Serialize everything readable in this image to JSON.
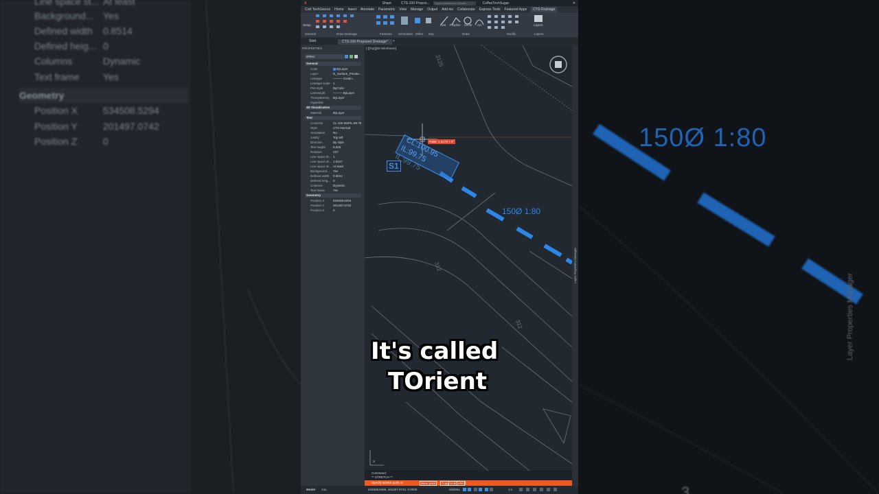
{
  "background_left": {
    "rows": [
      {
        "key": "Line space st...",
        "value": "At least"
      },
      {
        "key": "Background...",
        "value": "Yes"
      },
      {
        "key": "Defined width",
        "value": "0.8514"
      },
      {
        "key": "Defined heig...",
        "value": "0"
      },
      {
        "key": "Columns",
        "value": "Dynamic"
      },
      {
        "key": "Text frame",
        "value": "Yes"
      }
    ],
    "geometry_head": "Geometry",
    "geometry_rows": [
      {
        "key": "Position X",
        "value": "534508.5294"
      },
      {
        "key": "Position Y",
        "value": "201497.0742"
      },
      {
        "key": "Position Z",
        "value": "0"
      }
    ]
  },
  "background_right": {
    "pipe_label": "150Ø 1:80",
    "lpm_label": "Layer Properties Manager",
    "bottom_digit": "3"
  },
  "titlebar": {
    "share": "Share",
    "doc_title": "CTS-100-Propos...",
    "search_placeholder": "Type a keyword or phrase",
    "user": "CoffeeTechSugar"
  },
  "menu": [
    "Civil TechSource",
    "Home",
    "Insert",
    "Annotate",
    "Parametric",
    "View",
    "Manage",
    "Output",
    "Add-ins",
    "Collaborate",
    "Express Tools",
    "Featured Apps",
    "CTS-Drainage"
  ],
  "menu_active": "CTS-Drainage",
  "ribbon_groups": [
    "General",
    "Draw Drainage",
    "Features",
    "Schedules",
    "Other",
    "Key",
    "Draw",
    "Modify",
    "Layers"
  ],
  "ribbon_buttons": {
    "setup": "Setup",
    "line": "Line",
    "polyline": "Polyline",
    "circle": "Circle",
    "arc": "Arc",
    "layers": "Layers"
  },
  "doc_tabs": {
    "start": "Start",
    "active": "CTS-100-Proposed Drainage*"
  },
  "properties": {
    "title": "PROPERTIES",
    "selection": "MText",
    "sections": [
      {
        "name": "General",
        "rows": [
          {
            "key": "Color",
            "value": "ByLayer"
          },
          {
            "key": "Layer",
            "value": "D_Surface_Private..."
          },
          {
            "key": "Linetype",
            "value": "——— Contin..."
          },
          {
            "key": "Linetype scale",
            "value": "1"
          },
          {
            "key": "Plot style",
            "value": "ByColor"
          },
          {
            "key": "Lineweight",
            "value": "——— ByLayer"
          },
          {
            "key": "Transparency",
            "value": "ByLayer"
          },
          {
            "key": "Hyperlink",
            "value": ""
          }
        ]
      },
      {
        "name": "3D Visualization",
        "rows": [
          {
            "key": "Material",
            "value": "ByLayer"
          }
        ]
      },
      {
        "name": "Text",
        "rows": [
          {
            "key": "Contents",
            "value": "CL:100.95\\PIL:99.75"
          },
          {
            "key": "Style",
            "value": "CTS-Normal"
          },
          {
            "key": "Annotative",
            "value": "No"
          },
          {
            "key": "Justify",
            "value": "Top left"
          },
          {
            "key": "Direction",
            "value": "By style"
          },
          {
            "key": "Text height",
            "value": "0.625"
          },
          {
            "key": "Rotation",
            "value": "227"
          },
          {
            "key": "Line space fa...",
            "value": "1"
          },
          {
            "key": "Line space di...",
            "value": "1.0417"
          },
          {
            "key": "Line space st...",
            "value": "At least"
          },
          {
            "key": "Background...",
            "value": "Yes"
          },
          {
            "key": "Defined width",
            "value": "0.8514"
          },
          {
            "key": "Defined heig...",
            "value": "0"
          },
          {
            "key": "Columns",
            "value": "Dynamic"
          },
          {
            "key": "Text frame",
            "value": "Yes"
          }
        ]
      },
      {
        "name": "Geometry",
        "rows": [
          {
            "key": "Position X",
            "value": "534508.5294"
          },
          {
            "key": "Position Y",
            "value": "201497.0742"
          },
          {
            "key": "Position Z",
            "value": "0"
          }
        ]
      }
    ]
  },
  "drawing": {
    "view_label": "[-][Top][2D Wireframe]",
    "cursor_tip": "Polar: 1.5173 < 0°",
    "mtext_lines": [
      "CL:100.95",
      "IL:99.75",
      "IL:99.75"
    ],
    "manhole_label": "S1",
    "pipe_label": "150Ø 1:80",
    "parcels": [
      "312",
      "312",
      "312",
      "3125"
    ],
    "lpm_label": "Layer Properties Manager"
  },
  "command": {
    "history_1": "Command:",
    "history_2": "** STRETCH **",
    "prompt": "Specify stretch point or",
    "options": [
      "Base point",
      "Copy",
      "Undo",
      "eXit"
    ],
    "option_suffix": "]:"
  },
  "statusbar": {
    "model_tab": "Model",
    "layout_tab": "A1L",
    "coords": "534508.0466, 201497.0742, 0.0000",
    "mode": "MODEL",
    "scale": "1:1"
  },
  "caption": {
    "line1": "It's called",
    "line2": "TOrient"
  },
  "colors": {
    "accent": "#3d8eee",
    "command_bar": "#f05a22",
    "drawing_bg": "#212830"
  }
}
